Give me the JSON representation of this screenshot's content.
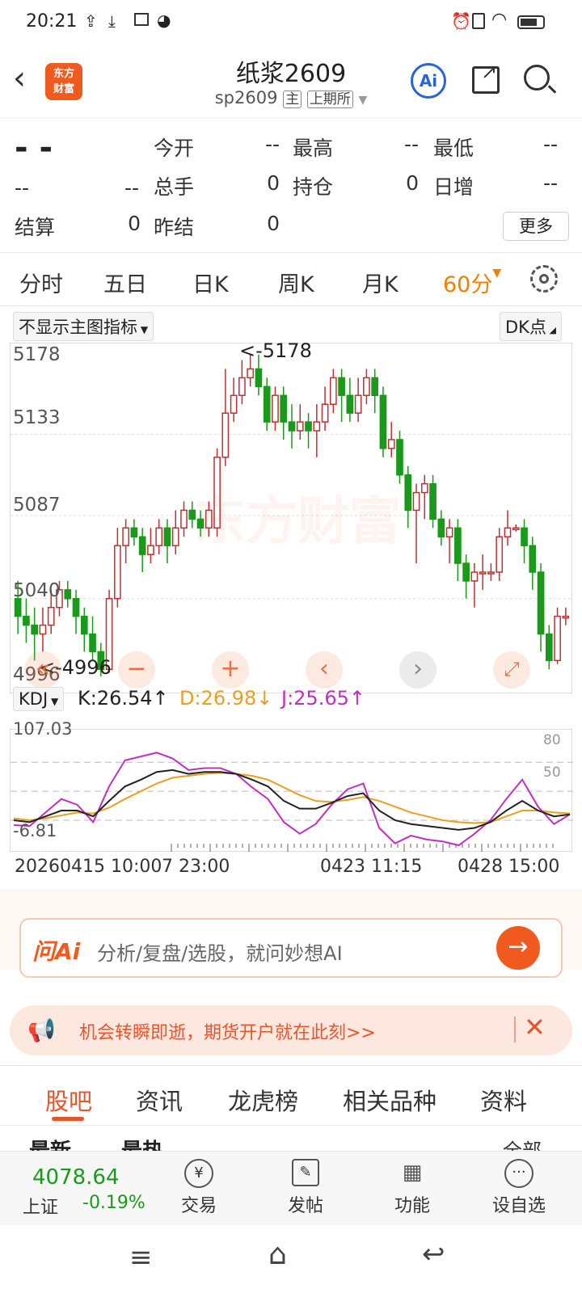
{
  "status_bar": {
    "time": "20:21"
  },
  "header": {
    "logo_text_1": "东方",
    "logo_text_2": "财富",
    "title": "纸浆2609",
    "code": "sp2609",
    "tag_main": "主",
    "tag_exchange": "上期所"
  },
  "quote": {
    "last_price": "- -",
    "change": "--",
    "change_pct": "--",
    "open_label": "今开",
    "open_value": "--",
    "high_label": "最高",
    "high_value": "--",
    "low_label": "最低",
    "low_value": "--",
    "volume_label": "总手",
    "volume_value": "0",
    "oi_label": "持仓",
    "oi_value": "0",
    "daily_inc_label": "日增",
    "daily_inc_value": "--",
    "settle_label": "结算",
    "settle_value": "0",
    "prev_settle_label": "昨结",
    "prev_settle_value": "0",
    "more_label": "更多"
  },
  "period_tabs": [
    "分时",
    "五日",
    "日K",
    "周K",
    "月K",
    "60分"
  ],
  "active_period": "60分",
  "chart_toolbar": {
    "indicator_select": "不显示主图指标",
    "dk_select": "DK点"
  },
  "chart_data": {
    "type": "candlestick",
    "y_ticks": [
      "5178",
      "5133",
      "5087",
      "5040",
      "4996"
    ],
    "ylim": [
      4996,
      5178
    ],
    "max_marker": "<-5178",
    "min_marker": "<-4996",
    "watermark": "东方财富",
    "x_labels": [
      "20260415 10:00",
      "7 23:00",
      "0423 11:15",
      "0428 15:00"
    ],
    "candles": [
      [
        5040,
        5030,
        5050,
        5020
      ],
      [
        5030,
        5025,
        5040,
        5015
      ],
      [
        5025,
        5020,
        5035,
        5005
      ],
      [
        5020,
        5025,
        5035,
        5010
      ],
      [
        5025,
        5035,
        5045,
        5020
      ],
      [
        5035,
        5045,
        5050,
        5030
      ],
      [
        5045,
        5040,
        5050,
        5035
      ],
      [
        5040,
        5030,
        5045,
        5020
      ],
      [
        5030,
        5020,
        5035,
        5010
      ],
      [
        5020,
        5010,
        5030,
        5005
      ],
      [
        5010,
        5000,
        5015,
        4996
      ],
      [
        5000,
        5040,
        5045,
        4998
      ],
      [
        5040,
        5070,
        5080,
        5035
      ],
      [
        5070,
        5080,
        5085,
        5060
      ],
      [
        5080,
        5075,
        5085,
        5070
      ],
      [
        5075,
        5065,
        5080,
        5055
      ],
      [
        5065,
        5070,
        5080,
        5060
      ],
      [
        5070,
        5080,
        5085,
        5065
      ],
      [
        5080,
        5070,
        5085,
        5060
      ],
      [
        5070,
        5080,
        5090,
        5065
      ],
      [
        5080,
        5090,
        5095,
        5075
      ],
      [
        5090,
        5085,
        5095,
        5080
      ],
      [
        5085,
        5080,
        5090,
        5075
      ],
      [
        5080,
        5090,
        5095,
        5075
      ],
      [
        5080,
        5120,
        5125,
        5075
      ],
      [
        5120,
        5145,
        5170,
        5115
      ],
      [
        5145,
        5155,
        5165,
        5140
      ],
      [
        5155,
        5165,
        5175,
        5150
      ],
      [
        5165,
        5170,
        5178,
        5160
      ],
      [
        5170,
        5160,
        5178,
        5155
      ],
      [
        5160,
        5140,
        5165,
        5135
      ],
      [
        5140,
        5155,
        5160,
        5135
      ],
      [
        5155,
        5140,
        5160,
        5130
      ],
      [
        5140,
        5135,
        5150,
        5125
      ],
      [
        5135,
        5140,
        5150,
        5130
      ],
      [
        5140,
        5135,
        5145,
        5125
      ],
      [
        5135,
        5140,
        5150,
        5120
      ],
      [
        5140,
        5150,
        5160,
        5135
      ],
      [
        5150,
        5165,
        5170,
        5145
      ],
      [
        5165,
        5155,
        5170,
        5140
      ],
      [
        5155,
        5145,
        5165,
        5140
      ],
      [
        5145,
        5155,
        5165,
        5140
      ],
      [
        5155,
        5165,
        5170,
        5150
      ],
      [
        5165,
        5155,
        5170,
        5145
      ],
      [
        5155,
        5125,
        5160,
        5120
      ],
      [
        5125,
        5130,
        5140,
        5120
      ],
      [
        5130,
        5110,
        5135,
        5105
      ],
      [
        5110,
        5090,
        5115,
        5080
      ],
      [
        5090,
        5100,
        5105,
        5060
      ],
      [
        5100,
        5105,
        5110,
        5085
      ],
      [
        5105,
        5085,
        5110,
        5080
      ],
      [
        5085,
        5075,
        5090,
        5070
      ],
      [
        5075,
        5080,
        5085,
        5060
      ],
      [
        5080,
        5060,
        5085,
        5050
      ],
      [
        5060,
        5050,
        5065,
        5040
      ],
      [
        5050,
        5055,
        5060,
        5035
      ],
      [
        5055,
        5055,
        5065,
        5045
      ],
      [
        5055,
        5055,
        5060,
        5050
      ],
      [
        5055,
        5075,
        5080,
        5050
      ],
      [
        5075,
        5080,
        5090,
        5070
      ],
      [
        5080,
        5080,
        5082,
        5078
      ],
      [
        5080,
        5070,
        5085,
        5060
      ],
      [
        5070,
        5055,
        5075,
        5045
      ],
      [
        5055,
        5020,
        5060,
        5010
      ],
      [
        5020,
        5005,
        5025,
        5000
      ],
      [
        5005,
        5030,
        5035,
        5003
      ],
      [
        5030,
        5030,
        5035,
        5025
      ]
    ]
  },
  "kdj": {
    "selector": "KDJ",
    "k_text": "K:26.54↑",
    "d_text": "D:26.98↓",
    "j_text": "J:25.65↑",
    "y_max": "107.03",
    "y_min": "-6.81",
    "level_80": "80",
    "level_50": "50",
    "k_color": "#222222",
    "d_color": "#e8a020",
    "j_color": "#c030c0",
    "k": [
      20,
      18,
      24,
      30,
      30,
      24,
      40,
      55,
      62,
      70,
      72,
      68,
      70,
      70,
      68,
      62,
      55,
      40,
      32,
      32,
      38,
      45,
      48,
      30,
      20,
      16,
      14,
      12,
      10,
      12,
      18,
      30,
      40,
      30,
      24,
      26
    ],
    "d": [
      22,
      20,
      22,
      25,
      28,
      27,
      33,
      42,
      50,
      58,
      64,
      66,
      68,
      69,
      68,
      66,
      62,
      54,
      46,
      40,
      39,
      41,
      44,
      40,
      34,
      28,
      24,
      20,
      18,
      17,
      18,
      24,
      30,
      30,
      28,
      27
    ],
    "j": [
      15,
      14,
      28,
      42,
      36,
      18,
      55,
      82,
      86,
      90,
      84,
      72,
      74,
      74,
      68,
      54,
      42,
      18,
      6,
      16,
      36,
      52,
      58,
      12,
      -4,
      4,
      0,
      -2,
      -6,
      6,
      20,
      42,
      62,
      34,
      16,
      26
    ]
  },
  "ai": {
    "brand": "问Ai",
    "placeholder": "分析/复盘/选股，就问妙想AI"
  },
  "banner": {
    "text": "机会转瞬即逝，期货开户就在此刻>>"
  },
  "bottom_tabs": [
    "股吧",
    "资讯",
    "龙虎榜",
    "相关品种",
    "资料"
  ],
  "active_bottom_tab": "股吧",
  "partial_row": {
    "left1": "最新",
    "left2": "最热",
    "right": "全部"
  },
  "tabbar": {
    "index_value": "4078.64",
    "index_name": "上证",
    "index_change": "-0.19%",
    "items": [
      "交易",
      "发帖",
      "功能",
      "设自选"
    ]
  },
  "colors": {
    "up": "#c03030",
    "down": "#1a9a1a",
    "accent": "#f08000",
    "brand": "#f05a1e"
  }
}
